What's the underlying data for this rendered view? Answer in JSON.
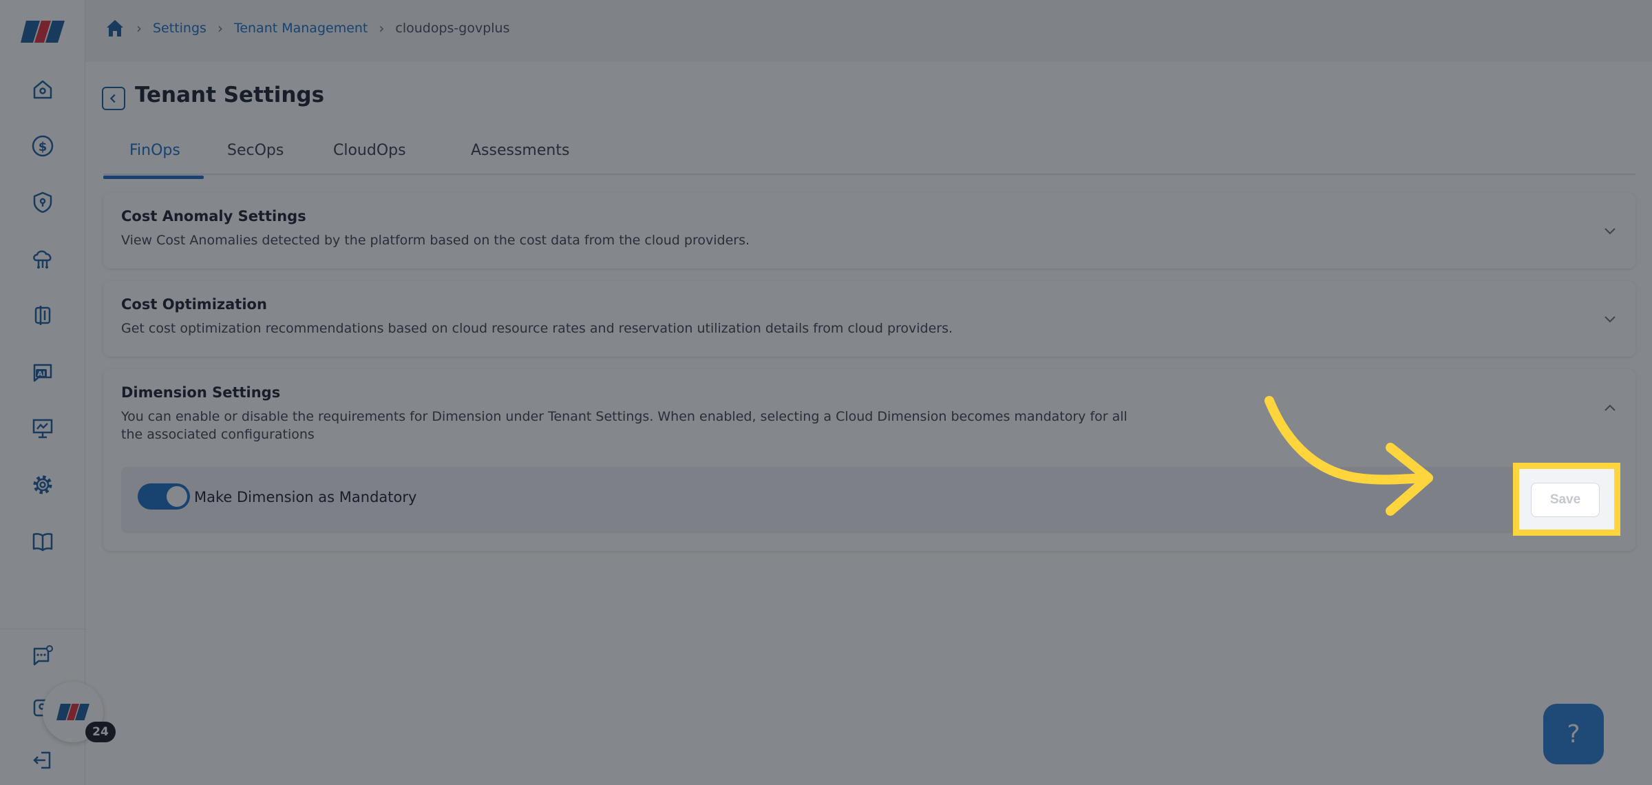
{
  "app": {
    "logo_icon": "brand-logo",
    "brand_colors": {
      "accent": "#1f6fc5",
      "highlight": "#ffd53d"
    }
  },
  "sidebar": {
    "items": [
      {
        "icon": "home-icon"
      },
      {
        "icon": "dollar-icon"
      },
      {
        "icon": "shield-icon"
      },
      {
        "icon": "cloud-network-icon"
      },
      {
        "icon": "resource-icon"
      },
      {
        "icon": "ai-chat-icon"
      },
      {
        "icon": "presentation-icon"
      },
      {
        "icon": "gear-icon"
      },
      {
        "icon": "book-icon"
      }
    ],
    "bottom_items": [
      {
        "icon": "chat-settings-icon"
      },
      {
        "icon": "user-chat-icon"
      },
      {
        "icon": "logout-icon"
      }
    ]
  },
  "breadcrumb": {
    "home_icon": "home-icon",
    "items": [
      "Settings",
      "Tenant Management",
      "cloudops-govplus"
    ]
  },
  "page": {
    "title": "Tenant Settings"
  },
  "tabs": [
    {
      "label": "FinOps",
      "active": true
    },
    {
      "label": "SecOps",
      "active": false
    },
    {
      "label": "CloudOps",
      "active": false
    },
    {
      "label": "Assessments",
      "active": false
    }
  ],
  "sections": {
    "cost_anomaly": {
      "title": "Cost Anomaly Settings",
      "description": "View Cost Anomalies detected by the platform based on the cost data from the cloud providers.",
      "expanded": false
    },
    "cost_optimization": {
      "title": "Cost Optimization",
      "description": "Get cost optimization recommendations based on cloud resource rates and reservation utilization details from cloud providers.",
      "expanded": false
    },
    "dimension": {
      "title": "Dimension Settings",
      "description_line1": "You can enable or disable the requirements for Dimension under Tenant Settings. When enabled, selecting a Cloud Dimension becomes mandatory for all",
      "description_line2": "the associated configurations",
      "expanded": true,
      "toggle_label": "Make Dimension as Mandatory",
      "toggle_on": true,
      "save_label": "Save"
    }
  },
  "widgets": {
    "notification_count": "24",
    "help_label": "?"
  }
}
